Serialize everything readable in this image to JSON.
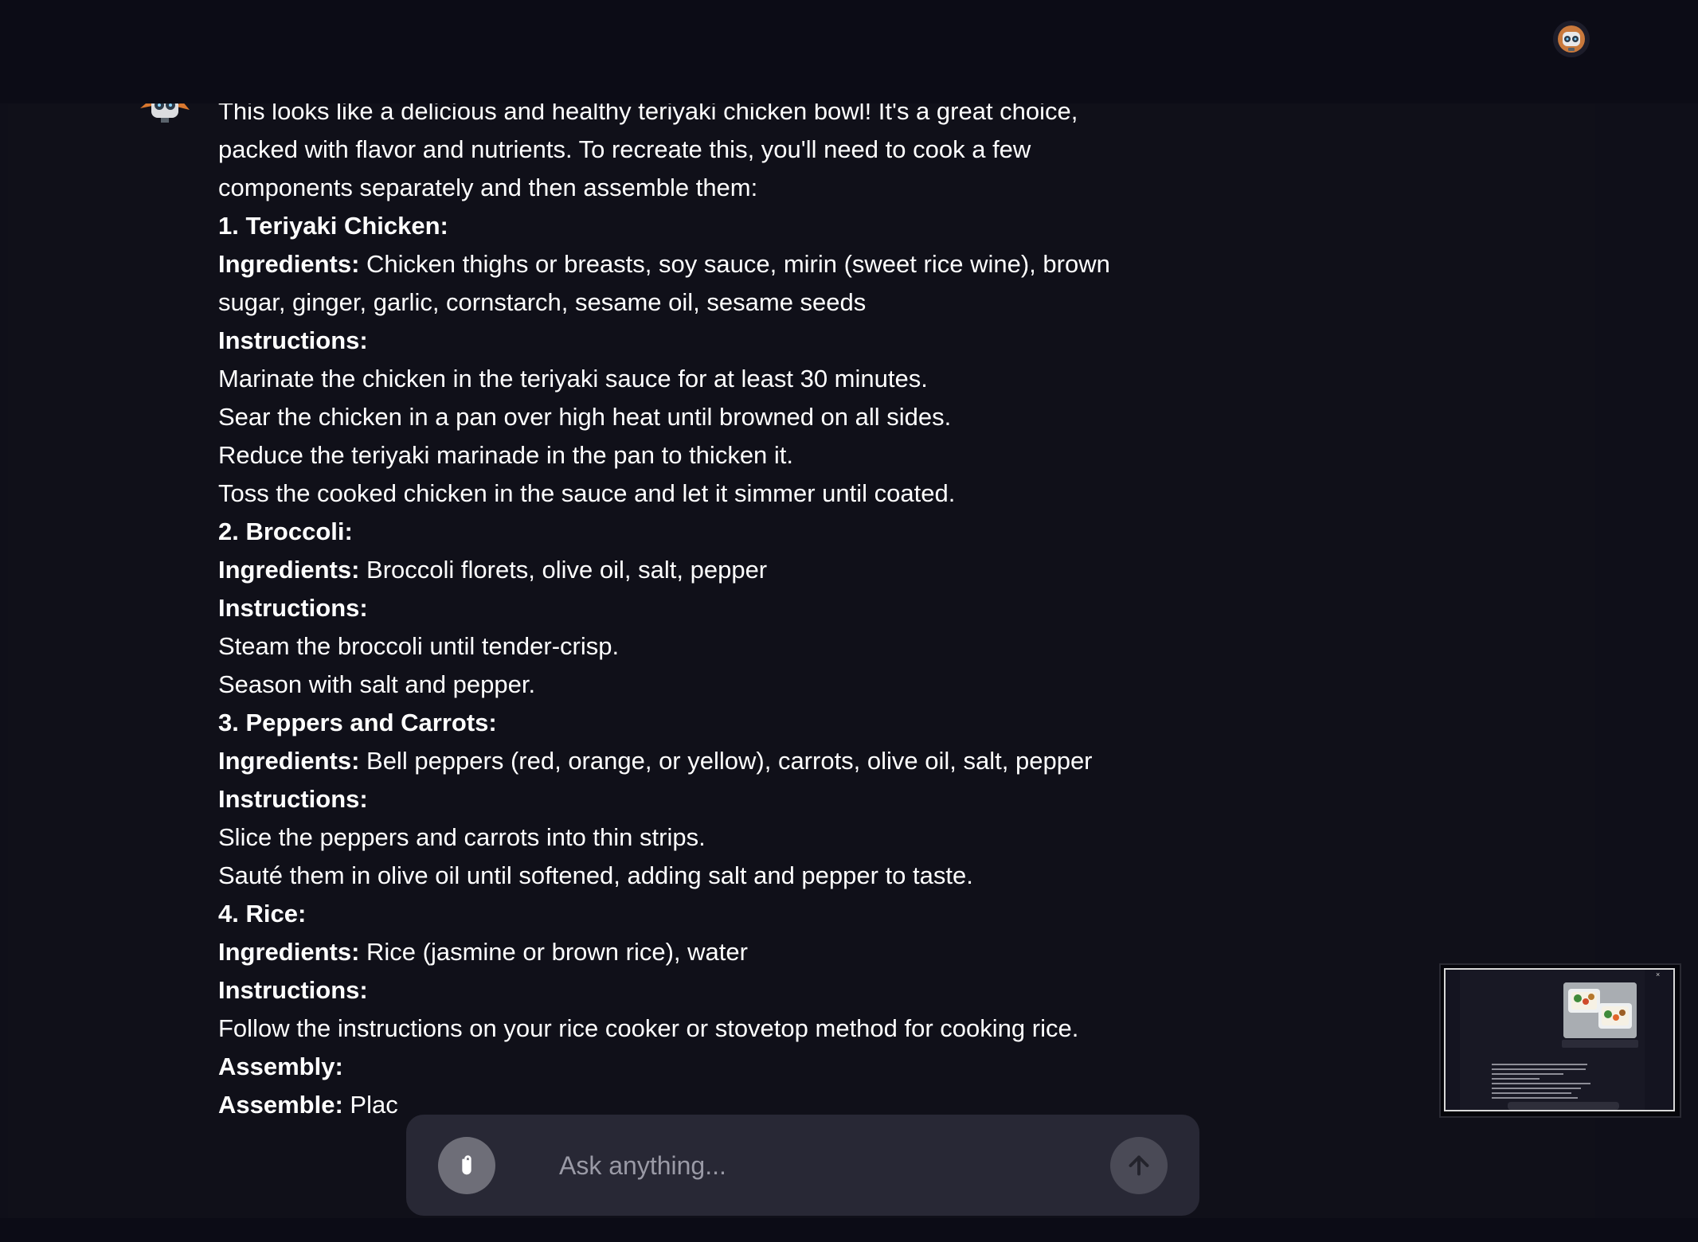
{
  "message": {
    "intro": "This looks like a delicious and healthy teriyaki chicken bowl! It's a great choice, packed with flavor and nutrients. To recreate this, you'll need to cook a few components separately and then assemble them:",
    "sections": [
      {
        "heading": "1. Teriyaki Chicken:",
        "ingredients_label": "Ingredients:",
        "ingredients": " Chicken thighs or breasts, soy sauce, mirin (sweet rice wine), brown sugar, ginger, garlic, cornstarch, sesame oil, sesame seeds",
        "instructions_label": "Instructions:",
        "steps": [
          "Marinate the chicken in the teriyaki sauce for at least 30 minutes.",
          "Sear the chicken in a pan over high heat until browned on all sides.",
          "Reduce the teriyaki marinade in the pan to thicken it.",
          "Toss the cooked chicken in the sauce and let it simmer until coated."
        ]
      },
      {
        "heading": "2. Broccoli:",
        "ingredients_label": "Ingredients:",
        "ingredients": " Broccoli florets, olive oil, salt, pepper",
        "instructions_label": "Instructions:",
        "steps": [
          "Steam the broccoli until tender-crisp.",
          "Season with salt and pepper."
        ]
      },
      {
        "heading": "3. Peppers and Carrots:",
        "ingredients_label": "Ingredients:",
        "ingredients": " Bell peppers (red, orange, or yellow), carrots, olive oil, salt, pepper",
        "instructions_label": "Instructions:",
        "steps": [
          "Slice the peppers and carrots into thin strips.",
          "Sauté them in olive oil until softened, adding salt and pepper to taste."
        ]
      },
      {
        "heading": "4. Rice:",
        "ingredients_label": "Ingredients:",
        "ingredients": " Rice (jasmine or brown rice), water",
        "instructions_label": "Instructions:",
        "steps": [
          "Follow the instructions on your rice cooker or stovetop method for cooking rice."
        ]
      }
    ],
    "assembly_heading": "Assembly:",
    "assemble_label": "Assemble:",
    "assemble_text": " Plac"
  },
  "composer": {
    "placeholder": "Ask anything..."
  },
  "icons": {
    "attach": "paperclip-icon",
    "send": "arrow-up-icon",
    "user_avatar": "robot-avatar-icon",
    "assistant_avatar": "robot-avatar-icon"
  },
  "colors": {
    "background": "#0f0f19",
    "composer": "#282835",
    "attach_button": "#6e6e78",
    "send_button": "#4a4a56",
    "text": "#ffffff"
  }
}
